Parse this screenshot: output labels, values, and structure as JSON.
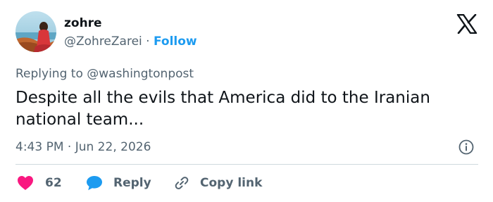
{
  "author": {
    "name": "zohre",
    "handle": "@ZohreZarei",
    "separator": "·",
    "follow_label": "Follow"
  },
  "reply_context": {
    "prefix": "Replying to ",
    "target": "@washingtonpost"
  },
  "tweet": {
    "text": "Despite all the evils that America did to the Iranian national team...",
    "time": "4:43 PM",
    "date": "Jun 22, 2026",
    "meta_separator": " · "
  },
  "actions": {
    "like_count": "62",
    "reply_label": "Reply",
    "copy_label": "Copy link"
  },
  "icons": {
    "logo": "x-logo-icon",
    "info": "info-icon",
    "like": "heart-icon",
    "reply": "speech-bubble-icon",
    "copy": "link-icon"
  },
  "colors": {
    "accent": "#1d9bf0",
    "like": "#f91880",
    "text": "#0f1419",
    "secondary": "#536471",
    "divider": "#cfd9de"
  }
}
